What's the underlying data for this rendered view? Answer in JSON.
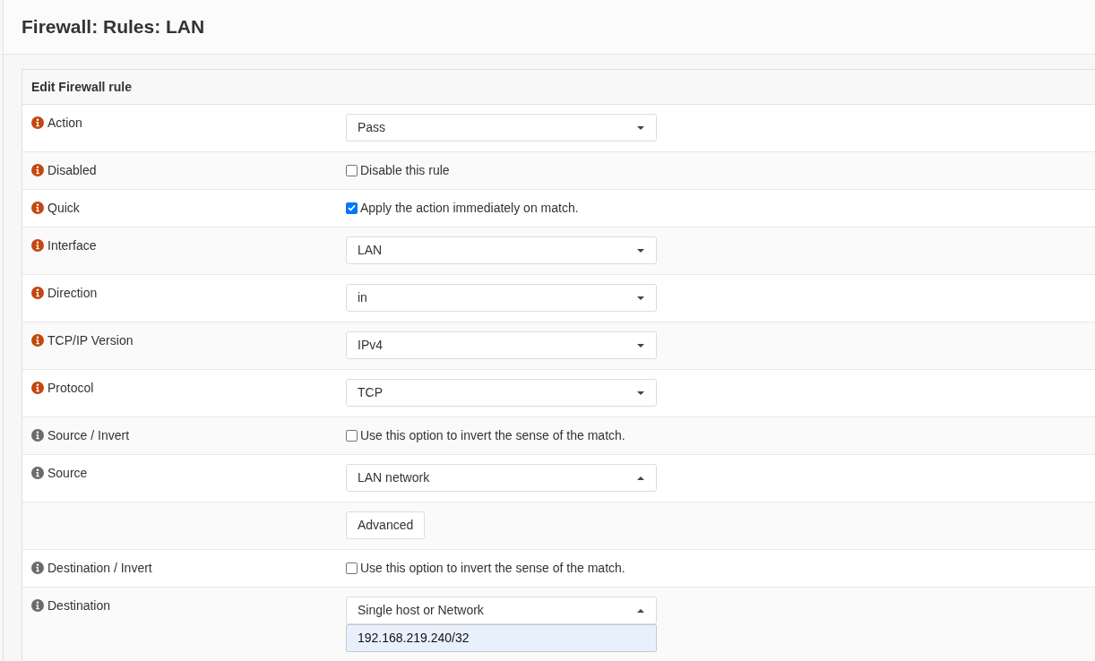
{
  "page": {
    "title": "Firewall: Rules: LAN"
  },
  "panel": {
    "heading": "Edit Firewall rule",
    "rows": [
      {
        "kind": "select",
        "label": "Action",
        "required": true,
        "value": "Pass",
        "expanded": false
      },
      {
        "kind": "checkbox",
        "label": "Disabled",
        "required": true,
        "checked": false,
        "text": "Disable this rule"
      },
      {
        "kind": "checkbox",
        "label": "Quick",
        "required": true,
        "checked": true,
        "text": "Apply the action immediately on match."
      },
      {
        "kind": "select",
        "label": "Interface",
        "required": true,
        "value": "LAN",
        "expanded": false
      },
      {
        "kind": "select",
        "label": "Direction",
        "required": true,
        "value": "in",
        "expanded": false
      },
      {
        "kind": "select",
        "label": "TCP/IP Version",
        "required": true,
        "value": "IPv4",
        "expanded": false
      },
      {
        "kind": "select",
        "label": "Protocol",
        "required": true,
        "value": "TCP",
        "expanded": false
      },
      {
        "kind": "checkbox",
        "label": "Source / Invert",
        "required": false,
        "checked": false,
        "text": "Use this option to invert the sense of the match."
      },
      {
        "kind": "select",
        "label": "Source",
        "required": false,
        "value": "LAN network",
        "expanded": true
      },
      {
        "kind": "button",
        "button": "Advanced"
      },
      {
        "kind": "checkbox",
        "label": "Destination / Invert",
        "required": false,
        "checked": false,
        "text": "Use this option to invert the sense of the match."
      },
      {
        "kind": "select",
        "label": "Destination",
        "required": false,
        "value": "Single host or Network",
        "expanded": true,
        "address": "192.168.219.240/32"
      }
    ]
  }
}
